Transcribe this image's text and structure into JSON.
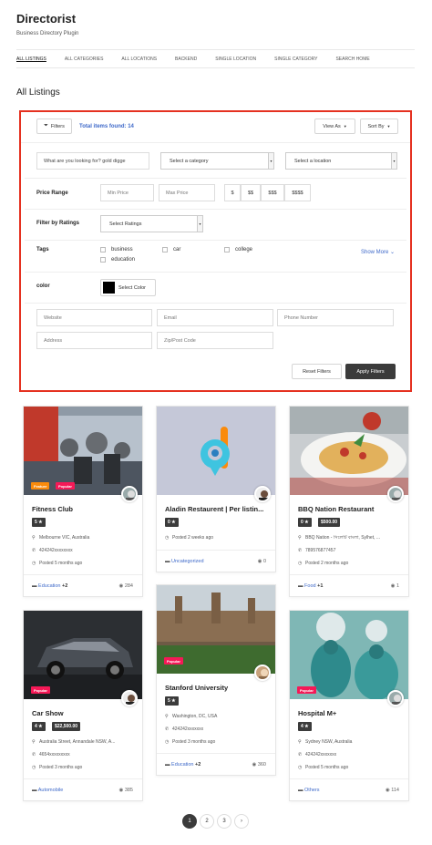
{
  "site": {
    "title": "Directorist",
    "description": "Business Directory Plugin"
  },
  "nav": [
    "ALL LISTINGS",
    "ALL CATEGORIES",
    "ALL LOCATIONS",
    "BACKEND",
    "SINGLE LOCATION",
    "SINGLE CATEGORY",
    "SEARCH HOME"
  ],
  "page_title": "All Listings",
  "filters": {
    "filters_button": "Filters",
    "total": "Total items found: 14",
    "view_as": "View As",
    "sort_by": "Sort By",
    "search_placeholder": "What are you looking for? gold digge",
    "category_select": "Select a category",
    "location_select": "Select a location",
    "price_range_label": "Price Range",
    "min_price": "Min Price",
    "max_price": "Max Price",
    "price_levels": [
      "$",
      "$$",
      "$$$",
      "$$$$"
    ],
    "ratings_label": "Filter by Ratings",
    "ratings_select": "Select Ratings",
    "tags_label": "Tags",
    "tags": [
      "business",
      "car",
      "college",
      "education"
    ],
    "show_more": "Show More",
    "color_label": "color",
    "select_color": "Select Color",
    "website": "Website",
    "email": "Email",
    "phone": "Phone Number",
    "address": "Address",
    "zip": "Zip/Post Code",
    "reset": "Reset Filters",
    "apply": "Apply Filters"
  },
  "listings": [
    {
      "title": "Fitness Club",
      "badges": [
        "Feature",
        "Popular"
      ],
      "rating": "5 ★",
      "price": "",
      "location": "Melbourne VIC, Australia",
      "phone": "424242xxxxxxxx",
      "posted": "Posted 5 months ago",
      "category": "Education",
      "more": "+2",
      "views": "284"
    },
    {
      "title": "Aladin Restaurent | Per listin...",
      "badges": [],
      "rating": "0 ★",
      "price": "",
      "location": "",
      "phone": "",
      "posted": "Posted 2 weeks ago",
      "category": "Uncategorized",
      "more": "",
      "views": "0"
    },
    {
      "title": "BBQ Nation Restaurant",
      "badges": [],
      "rating": "0 ★",
      "price": "$500.00",
      "location": "BBQ Nation - সিলেটি বাংলা, Sylhet, ...",
      "phone": "789576877457",
      "posted": "Posted 2 months ago",
      "category": "Food",
      "more": "+1",
      "views": "1"
    },
    {
      "title": "Car Show",
      "badges": [
        "Popular"
      ],
      "rating": "4 ★",
      "price": "$22,500.00",
      "location": "Australia Street, Annandale NSW, A...",
      "phone": "4654xxxxxxxxx",
      "posted": "Posted 3 months ago",
      "category": "Automobile",
      "more": "",
      "views": "385"
    },
    {
      "title": "Stanford University",
      "badges": [
        "Popular"
      ],
      "rating": "5 ★",
      "price": "",
      "location": "Washington, DC, USA",
      "phone": "424242xxxxxxx",
      "posted": "Posted 3 months ago",
      "category": "Education",
      "more": "+2",
      "views": "360"
    },
    {
      "title": "Hospital M+",
      "badges": [
        "Popular"
      ],
      "rating": "4 ★",
      "price": "",
      "location": "Sydney NSW, Australia",
      "phone": "424242xxxxxxx",
      "posted": "Posted 5 months ago",
      "category": "Others",
      "more": "",
      "views": "114"
    }
  ],
  "pagination": [
    "1",
    "2",
    "3",
    "›"
  ],
  "colors": {
    "accent": "#3e69c9",
    "border_highlight": "#e53120",
    "dark": "#3b3b3b",
    "feature": "#fa8b0c",
    "popular": "#f51957"
  }
}
